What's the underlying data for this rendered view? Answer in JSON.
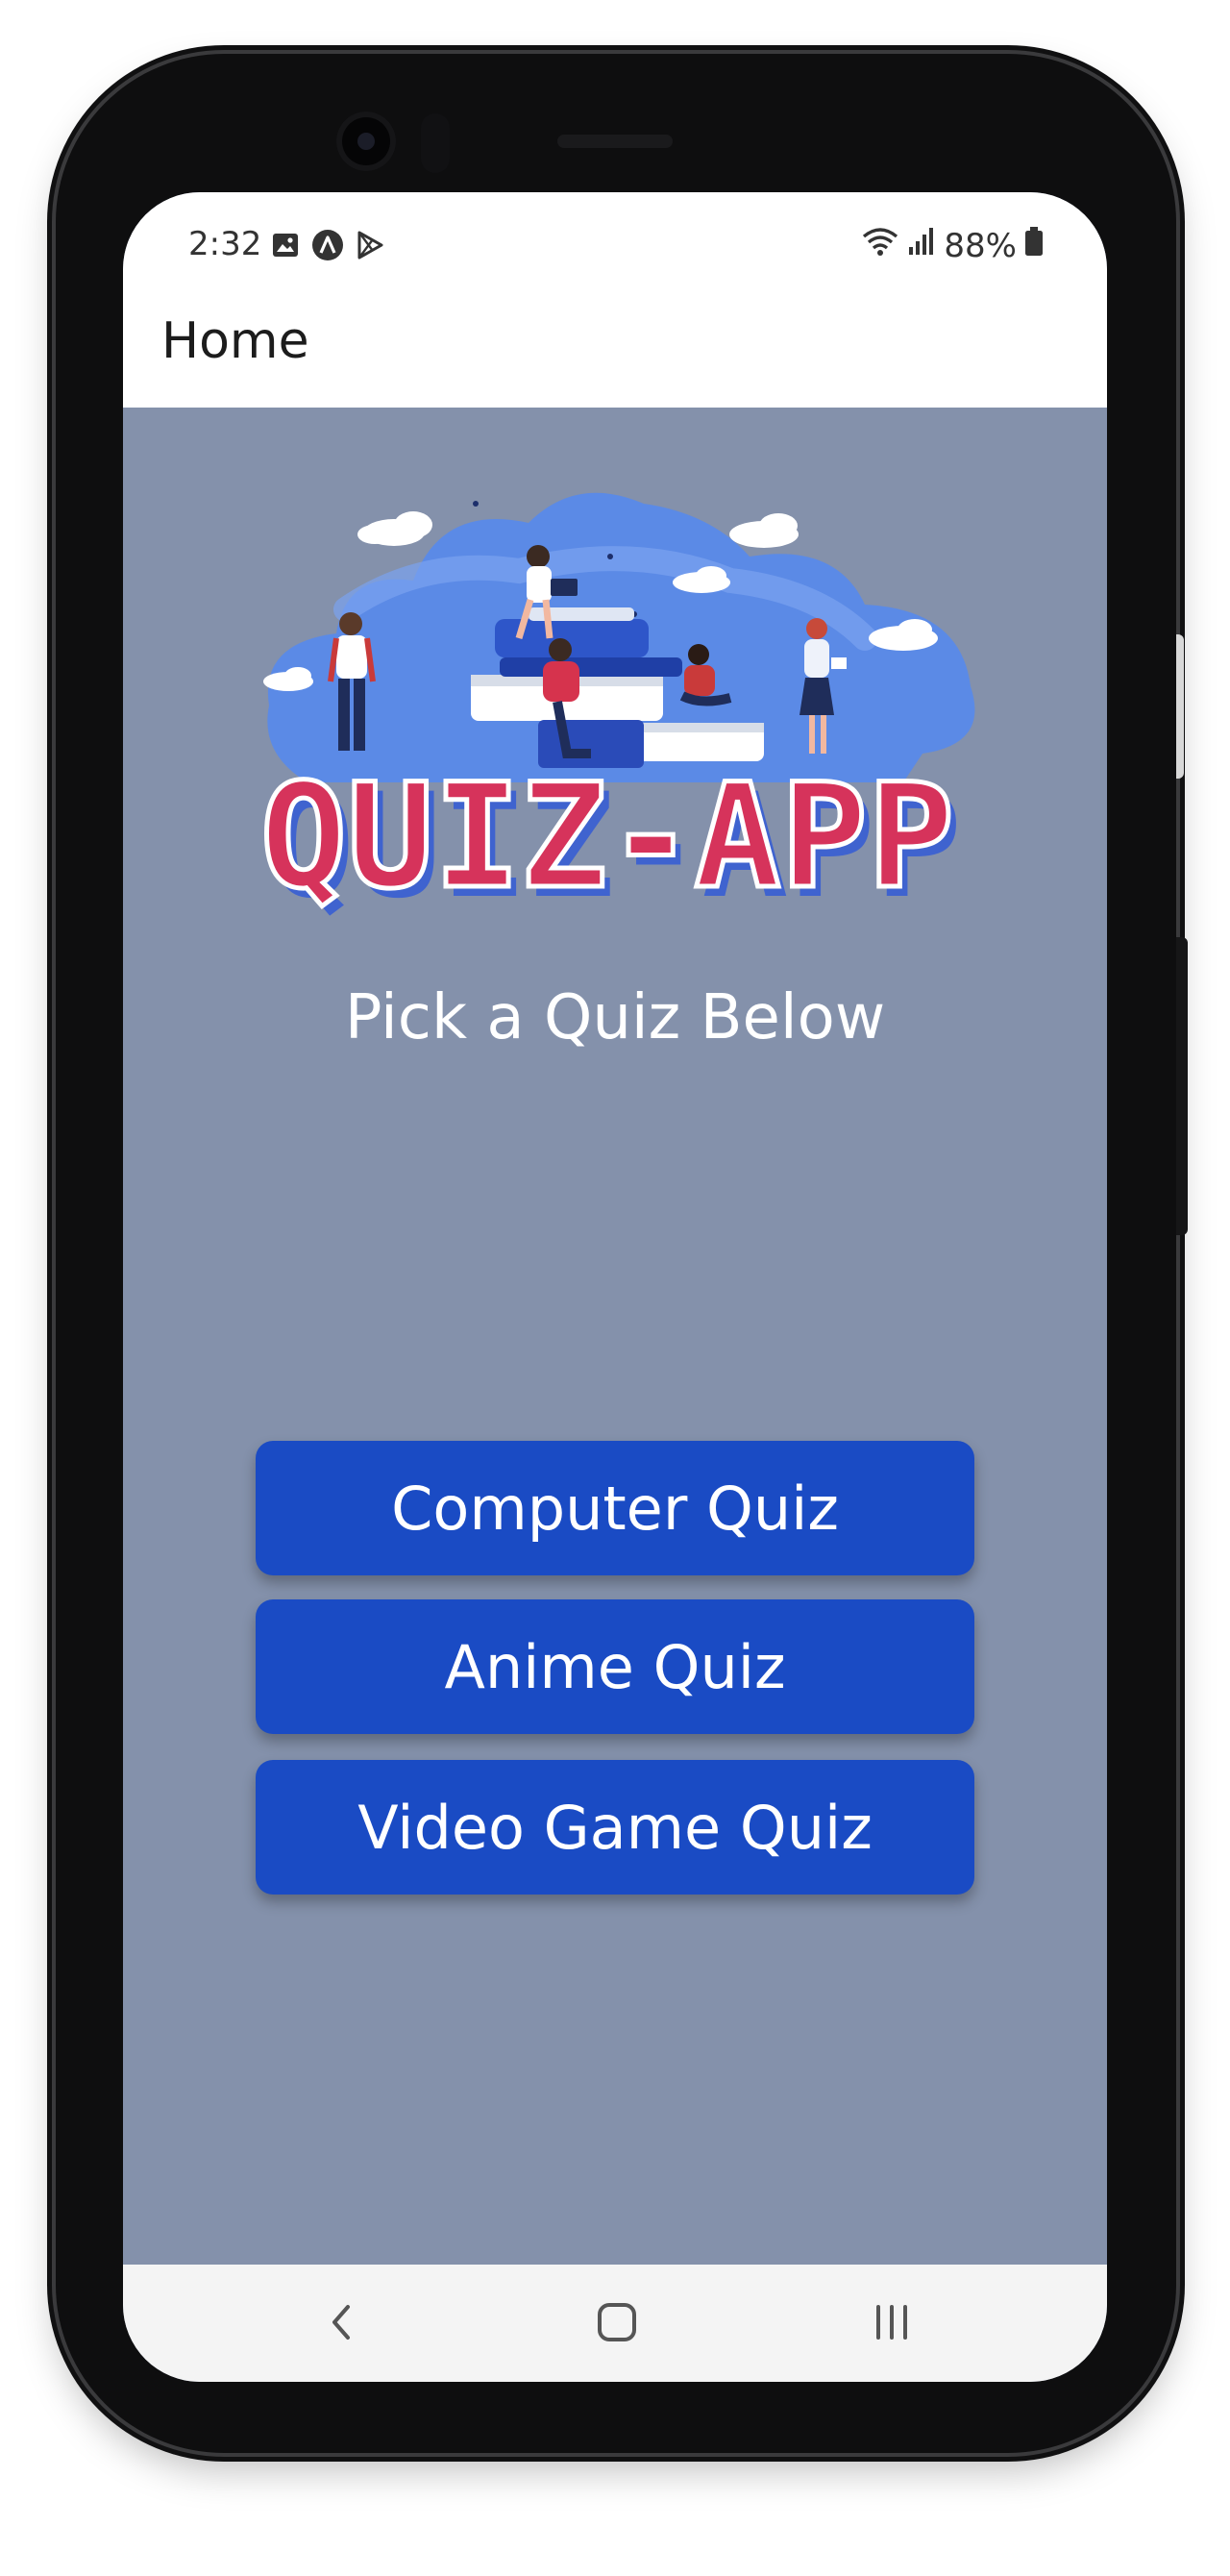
{
  "status_bar": {
    "time": "2:32",
    "battery": "88%",
    "icons": [
      "image-icon",
      "app-a-icon",
      "play-store-icon",
      "wifi-icon",
      "signal-icon",
      "battery-icon"
    ]
  },
  "app_bar": {
    "title": "Home"
  },
  "hero": {
    "logo_text": "QUIZ-APP",
    "logo_colors": {
      "fill": "#d6335b",
      "outline": "#ffffff",
      "sky": "#5b8ae6",
      "shadow": "#3f63cf"
    }
  },
  "main": {
    "heading": "Pick a Quiz Below",
    "buttons": [
      {
        "label": "Computer Quiz"
      },
      {
        "label": "Anime Quiz"
      },
      {
        "label": "Video Game Quiz"
      }
    ]
  },
  "colors": {
    "background": "#8491ab",
    "button": "#1a4bc4",
    "button_text": "#ffffff"
  },
  "nav_bar": {
    "icons": [
      "back-icon",
      "home-icon",
      "recents-icon"
    ]
  }
}
